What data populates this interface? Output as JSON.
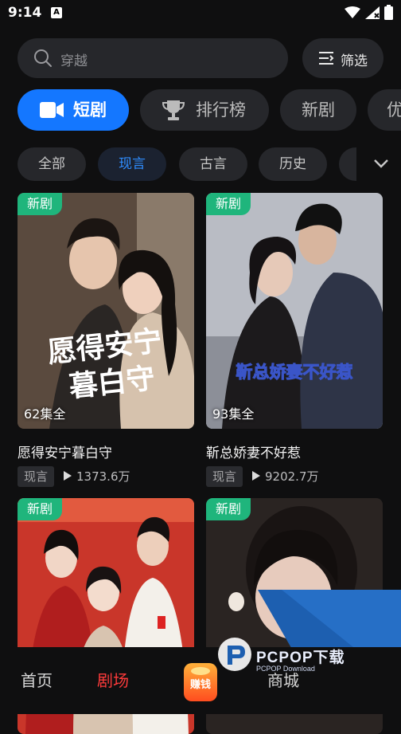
{
  "status_bar": {
    "time": "9:14",
    "notif_letter": "A"
  },
  "search": {
    "placeholder": "穿越",
    "filter_label": "筛选"
  },
  "main_tabs": [
    {
      "label": "短剧",
      "active": true,
      "icon": "video-camera-icon"
    },
    {
      "label": "排行榜",
      "active": false,
      "icon": "trophy-icon"
    },
    {
      "label": "新剧",
      "active": false
    },
    {
      "label": "优",
      "active": false
    }
  ],
  "sub_tabs": [
    {
      "label": "全部",
      "active": false
    },
    {
      "label": "现言",
      "active": true
    },
    {
      "label": "古言",
      "active": false
    },
    {
      "label": "历史",
      "active": false
    }
  ],
  "cards": [
    {
      "badge": "新剧",
      "episodes": "62集全",
      "poster_text": "愿得安宁\n暮白守",
      "title": "愿得安宁暮白守",
      "tag": "现言",
      "plays": "1373.6万"
    },
    {
      "badge": "新剧",
      "episodes": "93集全",
      "poster_text": "靳总娇妻不好惹",
      "title": "靳总娇妻不好惹",
      "tag": "现言",
      "plays": "9202.7万"
    },
    {
      "badge": "新剧"
    },
    {
      "badge": "新剧"
    }
  ],
  "bottom_nav": [
    {
      "label": "首页",
      "active": false
    },
    {
      "label": "剧场",
      "active": true
    },
    {
      "label": "赚钱",
      "active": false
    },
    {
      "label": "商城",
      "active": false
    }
  ],
  "watermark": {
    "title": "PCPOP下载",
    "subtitle": "PCPOP Download"
  },
  "colors": {
    "accent": "#1477ff",
    "badge_green": "#1fb57c",
    "nav_active": "#ff3b3b",
    "background": "#0f0f10"
  }
}
